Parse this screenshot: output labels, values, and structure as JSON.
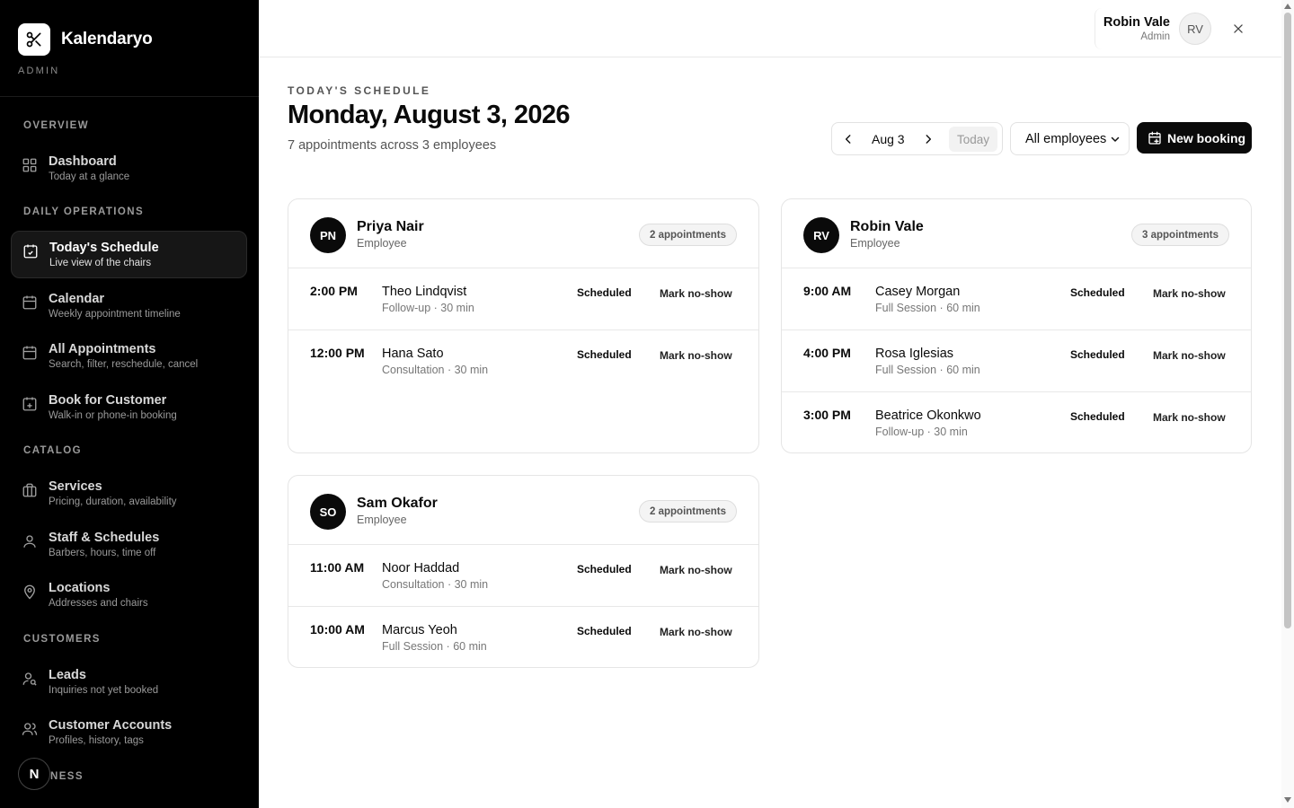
{
  "brand": {
    "name": "Kalendaryo",
    "sub": "ADMIN"
  },
  "sidebar": {
    "sections": {
      "overview": "OVERVIEW",
      "daily": "DAILY OPERATIONS",
      "catalog": "CATALOG",
      "customers": "CUSTOMERS",
      "business": "NESS"
    },
    "items": [
      {
        "label": "Dashboard",
        "desc": "Today at a glance"
      },
      {
        "label": "Today's Schedule",
        "desc": "Live view of the chairs"
      },
      {
        "label": "Calendar",
        "desc": "Weekly appointment timeline"
      },
      {
        "label": "All Appointments",
        "desc": "Search, filter, reschedule, cancel"
      },
      {
        "label": "Book for Customer",
        "desc": "Walk-in or phone-in booking"
      },
      {
        "label": "Services",
        "desc": "Pricing, duration, availability"
      },
      {
        "label": "Staff & Schedules",
        "desc": "Barbers, hours, time off"
      },
      {
        "label": "Locations",
        "desc": "Addresses and chairs"
      },
      {
        "label": "Leads",
        "desc": "Inquiries not yet booked"
      },
      {
        "label": "Customer Accounts",
        "desc": "Profiles, history, tags"
      }
    ],
    "badge": "N"
  },
  "user": {
    "name": "Robin Vale",
    "role": "Admin",
    "initials": "RV"
  },
  "header": {
    "eyebrow": "TODAY'S SCHEDULE",
    "title": "Monday, August 3, 2026",
    "subtitle": "7 appointments across 3 employees"
  },
  "controls": {
    "date": "Aug 3",
    "today": "Today",
    "employee_filter": "All employees",
    "new_booking": "New booking"
  },
  "cards": [
    {
      "initials": "PN",
      "name": "Priya Nair",
      "role": "Employee",
      "count": "2 appointments",
      "rows": [
        {
          "time": "2:00 PM",
          "customer": "Theo Lindqvist",
          "service": "Follow-up · 30 min",
          "status": "Scheduled",
          "action": "Mark no-show"
        },
        {
          "time": "12:00 PM",
          "customer": "Hana Sato",
          "service": "Consultation · 30 min",
          "status": "Scheduled",
          "action": "Mark no-show"
        }
      ]
    },
    {
      "initials": "RV",
      "name": "Robin Vale",
      "role": "Employee",
      "count": "3 appointments",
      "rows": [
        {
          "time": "9:00 AM",
          "customer": "Casey Morgan",
          "service": "Full Session · 60 min",
          "status": "Scheduled",
          "action": "Mark no-show"
        },
        {
          "time": "4:00 PM",
          "customer": "Rosa Iglesias",
          "service": "Full Session · 60 min",
          "status": "Scheduled",
          "action": "Mark no-show"
        },
        {
          "time": "3:00 PM",
          "customer": "Beatrice Okonkwo",
          "service": "Follow-up · 30 min",
          "status": "Scheduled",
          "action": "Mark no-show"
        }
      ]
    },
    {
      "initials": "SO",
      "name": "Sam Okafor",
      "role": "Employee",
      "count": "2 appointments",
      "rows": [
        {
          "time": "11:00 AM",
          "customer": "Noor Haddad",
          "service": "Consultation · 30 min",
          "status": "Scheduled",
          "action": "Mark no-show"
        },
        {
          "time": "10:00 AM",
          "customer": "Marcus Yeoh",
          "service": "Full Session · 60 min",
          "status": "Scheduled",
          "action": "Mark no-show"
        }
      ]
    }
  ]
}
